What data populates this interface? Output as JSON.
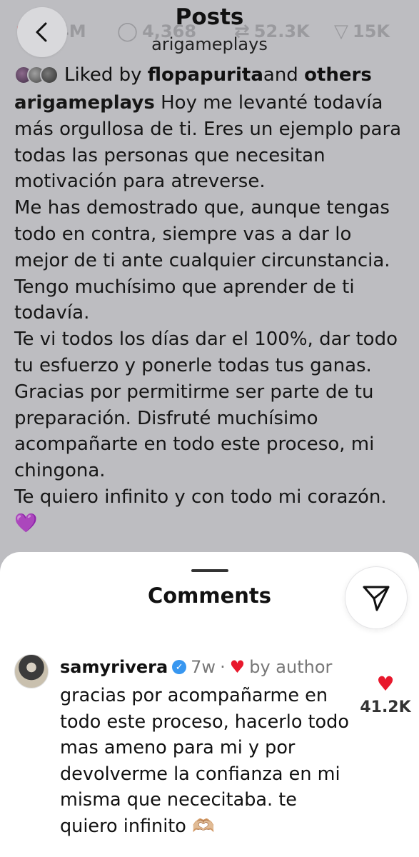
{
  "header": {
    "title": "Posts",
    "subtitle": "arigameplays",
    "back_icon": "chevron-left-icon"
  },
  "stats": {
    "likes": "4M",
    "comments": "4,368",
    "reposts": "52.3K",
    "shares": "15K"
  },
  "liked_by": {
    "prefix": "Liked by ",
    "user": "flopapurita",
    "and": " and ",
    "others": "others"
  },
  "caption": {
    "username": "arigameplays",
    "p1": " Hoy me levanté todavía más orgullosa de ti. Eres un ejemplo para todas las personas que necesitan motivación para atreverse.",
    "p2": "Me has demostrado que, aunque tengas todo en contra, siempre vas a dar lo mejor de ti ante cualquier circunstancia. Tengo muchísimo que aprender de ti todavía.",
    "p3": "Te vi todos los días dar el 100%, dar todo tu esfuerzo y ponerle todas tus ganas. Gracias por permitirme ser parte de tu preparación. Disfruté muchísimo acompañarte en todo este proceso, mi chingona.",
    "p4": "Te quiero infinito y con todo mi corazón. ",
    "p4_emoji": "💜"
  },
  "comments_sheet": {
    "title": "Comments",
    "share_icon": "send-icon"
  },
  "comment": {
    "username": "samyrivera",
    "time": "7w",
    "separator": "·",
    "author_label": "by author",
    "text": "gracias por acompañarme en todo este proceso, hacerlo todo mas ameno para mi y por devolverme la confianza en mi misma que nececitaba. te quiero infinito 🫶🏼",
    "likes": "41.2K"
  },
  "colors": {
    "accent_heart": "#e8182c",
    "verified": "#3897f0",
    "background_dim": "#bdbdc1"
  }
}
